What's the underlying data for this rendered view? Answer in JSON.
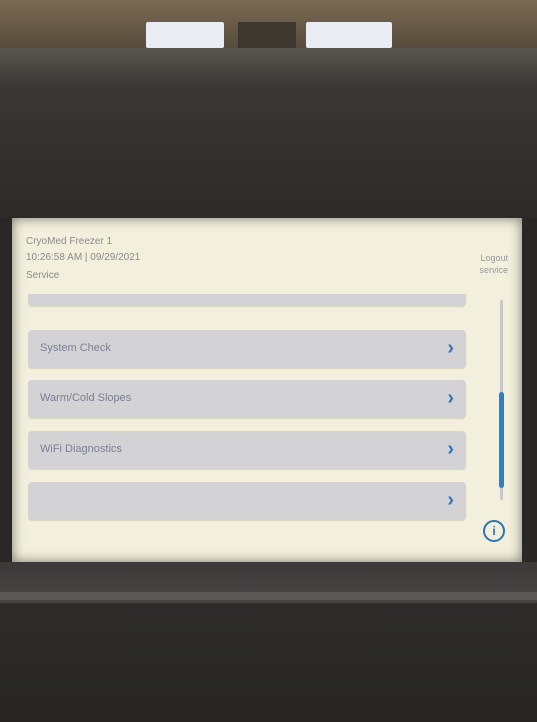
{
  "header": {
    "device_name": "CryoMed Freezer 1",
    "datetime": "10:26:58 AM | 09/29/2021",
    "mode": "Service"
  },
  "logout": {
    "line1": "Logout",
    "line2": "service"
  },
  "menu": {
    "items": [
      {
        "label": "System Check",
        "icon": "chevron-right-icon"
      },
      {
        "label": "Warm/Cold Slopes",
        "icon": "chevron-right-icon"
      },
      {
        "label": "WiFi Diagnostics",
        "icon": "chevron-right-icon"
      }
    ]
  },
  "info_icon": "info-icon",
  "colors": {
    "screen_background": "#f2efdc",
    "row_background": "#d3d3d6",
    "accent": "#2e7fc4"
  }
}
